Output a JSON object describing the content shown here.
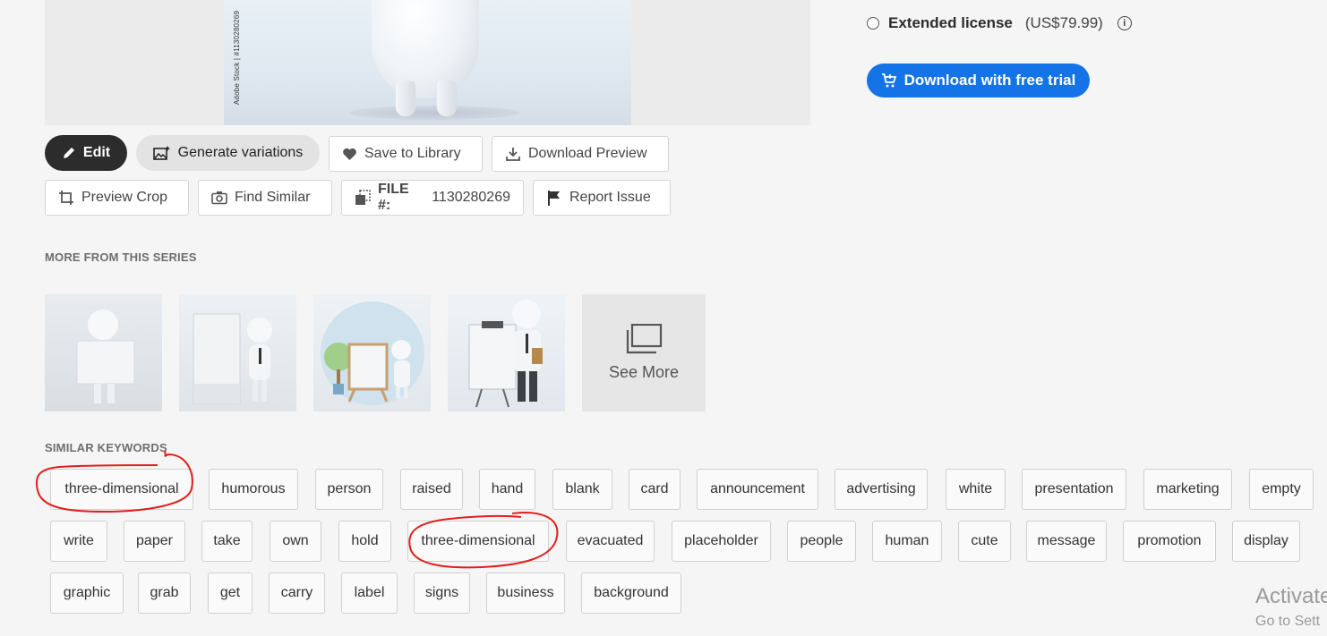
{
  "preview": {
    "watermark": "Adobe Stock | #1130280269"
  },
  "license": {
    "name": "Extended license",
    "price": "(US$79.99)",
    "info_icon": "info-icon"
  },
  "download_trial_label": "Download with free trial",
  "actions": {
    "edit": "Edit",
    "generate": "Generate variations",
    "save": "Save to Library",
    "download_preview": "Download Preview",
    "preview_crop": "Preview Crop",
    "find_similar": "Find Similar",
    "file_label": "FILE #:",
    "file_number": "1130280269",
    "report": "Report Issue"
  },
  "series": {
    "heading": "MORE FROM THIS SERIES",
    "see_more": "See More"
  },
  "keywords": {
    "heading": "SIMILAR KEYWORDS",
    "items": [
      "three-dimensional",
      "humorous",
      "person",
      "raised",
      "hand",
      "blank",
      "card",
      "announcement",
      "advertising",
      "white",
      "presentation",
      "marketing",
      "empty",
      "write",
      "paper",
      "take",
      "own",
      "hold",
      "three-dimensional",
      "evacuated",
      "placeholder",
      "people",
      "human",
      "cute",
      "message",
      "promotion",
      "display",
      "graphic",
      "grab",
      "get",
      "carry",
      "label",
      "signs",
      "business",
      "background"
    ]
  },
  "os_overlay": {
    "line1": "Activate",
    "line2": "Go to Sett"
  },
  "colors": {
    "accent": "#1473e6",
    "annotation": "#e0201b"
  }
}
